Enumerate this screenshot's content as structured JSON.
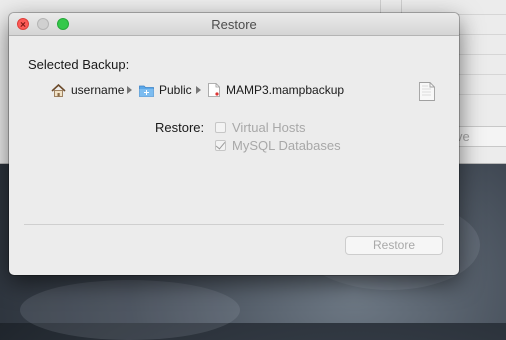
{
  "background_window": {
    "partial_button_label": "ve"
  },
  "dialog": {
    "title": "Restore",
    "selected_backup_label": "Selected Backup:",
    "path": [
      {
        "label": "username",
        "icon": "home-icon"
      },
      {
        "label": "Public",
        "icon": "folder-icon"
      },
      {
        "label": "MAMP3.mampbackup",
        "icon": "document-icon"
      }
    ],
    "restore_label": "Restore:",
    "options": [
      {
        "label": "Virtual Hosts",
        "checked": false,
        "enabled": false
      },
      {
        "label": "MySQL Databases",
        "checked": true,
        "enabled": false
      }
    ],
    "restore_button": "Restore"
  },
  "colors": {
    "close": "#fc5b57",
    "minimize": "#d0d0d0",
    "zoom": "#34c84a",
    "folder": "#5aa7e8"
  }
}
